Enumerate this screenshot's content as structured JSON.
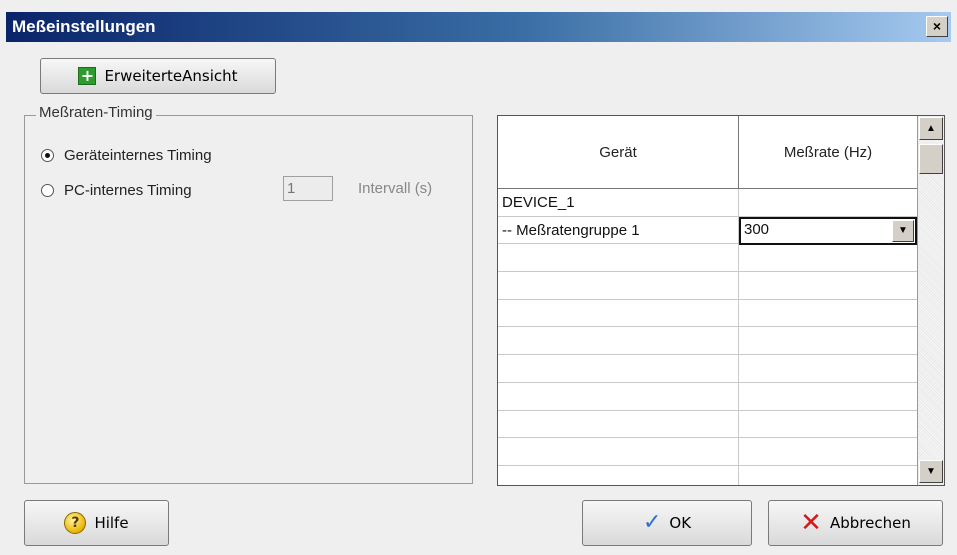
{
  "window": {
    "title": "Meßeinstellungen",
    "close_glyph": "×"
  },
  "toolbar": {
    "extended_view_label": "ErweiterteAnsicht",
    "extended_view_icon": "plus-icon"
  },
  "timing": {
    "group_title": "Meßraten-Timing",
    "option_device": "Geräteinternes Timing",
    "option_pc": "PC-internes Timing",
    "selected": "device",
    "interval_value": "1",
    "interval_label": "Intervall (s)"
  },
  "grid": {
    "columns": [
      "Gerät",
      "Meßrate (Hz)"
    ],
    "rows": [
      {
        "device": "DEVICE_1",
        "rate": ""
      },
      {
        "device": "-- Meßratengruppe 1",
        "rate": "300"
      },
      {
        "device": "",
        "rate": ""
      },
      {
        "device": "",
        "rate": ""
      },
      {
        "device": "",
        "rate": ""
      },
      {
        "device": "",
        "rate": ""
      },
      {
        "device": "",
        "rate": ""
      },
      {
        "device": "",
        "rate": ""
      },
      {
        "device": "",
        "rate": ""
      },
      {
        "device": "",
        "rate": ""
      },
      {
        "device": "",
        "rate": ""
      }
    ]
  },
  "buttons": {
    "help_label": "Hilfe",
    "ok_label": "OK",
    "cancel_label": "Abbrechen"
  },
  "colors": {
    "titlebar_start": "#0a246a",
    "ok_check": "#2a6fd6",
    "cancel_x": "#d21b1b"
  }
}
